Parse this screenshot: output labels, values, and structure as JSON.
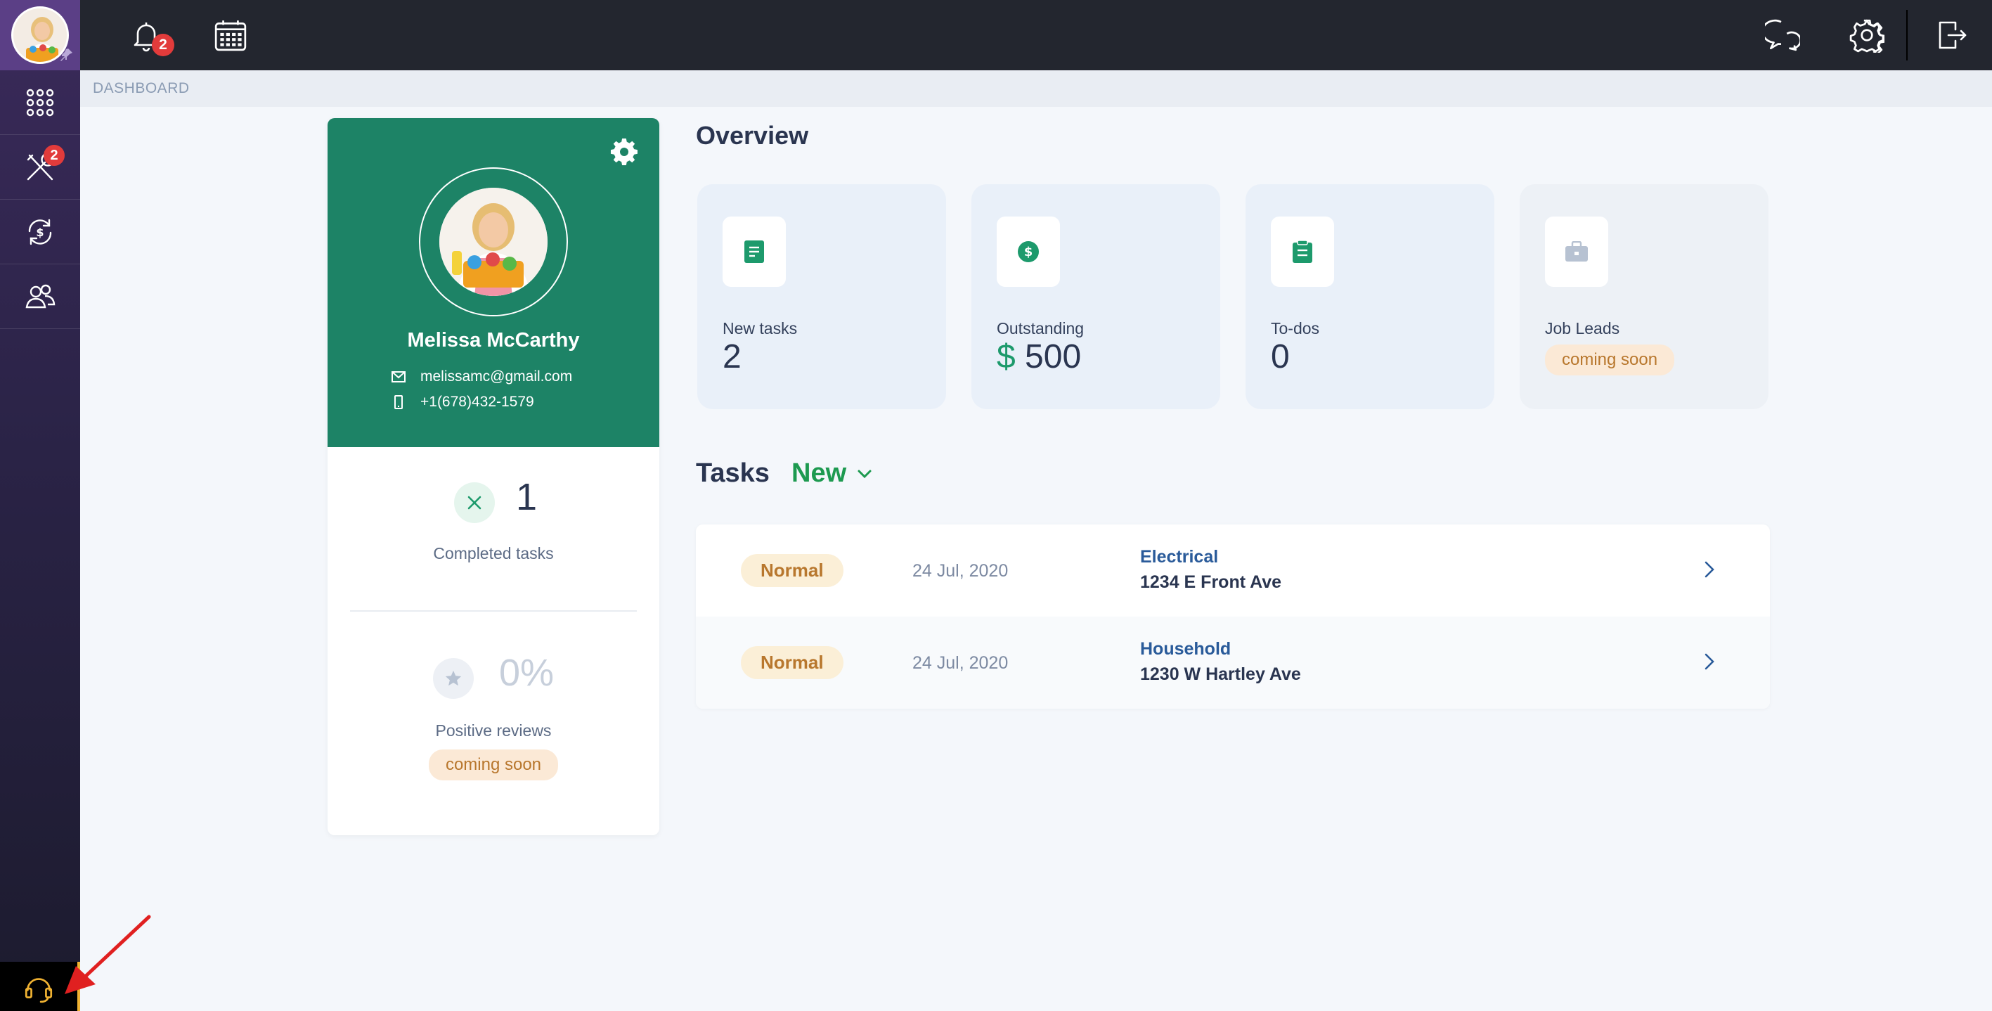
{
  "sidebar": {
    "items": [
      {
        "name": "apps-grid-icon"
      },
      {
        "name": "tools-icon",
        "badge": "2"
      },
      {
        "name": "payments-icon"
      },
      {
        "name": "contacts-icon"
      }
    ],
    "support": {
      "name": "headset-icon"
    }
  },
  "topbar": {
    "notifications_badge": "2"
  },
  "breadcrumb": "DASHBOARD",
  "profile": {
    "name": "Melissa McCarthy",
    "email": "melissamc@gmail.com",
    "phone": "+1(678)432-1579",
    "completed_tasks_value": "1",
    "completed_tasks_label": "Completed tasks",
    "positive_reviews_value": "0%",
    "positive_reviews_label": "Positive reviews",
    "positive_reviews_badge": "coming soon"
  },
  "overview": {
    "title": "Overview",
    "cards": [
      {
        "label": "New tasks",
        "value": "2",
        "icon": "document-icon",
        "color": "#1d9a6c"
      },
      {
        "label": "Outstanding",
        "currency": "$",
        "value": "500",
        "icon": "dollar-icon",
        "color": "#1d9a6c"
      },
      {
        "label": "To-dos",
        "value": "0",
        "icon": "clipboard-icon",
        "color": "#1d9a6c"
      },
      {
        "label": "Job Leads",
        "badge": "coming soon",
        "icon": "briefcase-icon",
        "color": "#b7c2d2"
      }
    ]
  },
  "tasks": {
    "title": "Tasks",
    "filter": "New",
    "rows": [
      {
        "priority": "Normal",
        "date": "24 Jul, 2020",
        "category": "Electrical",
        "address": "1234 E Front Ave"
      },
      {
        "priority": "Normal",
        "date": "24 Jul, 2020",
        "category": "Household",
        "address": "1230 W Hartley Ave"
      }
    ]
  },
  "colors": {
    "sidebar": "#2a2346",
    "topbar": "#23262f",
    "profile_green": "#1d8366",
    "accent_green": "#1d9a50",
    "badge_red": "#e23b3b"
  }
}
